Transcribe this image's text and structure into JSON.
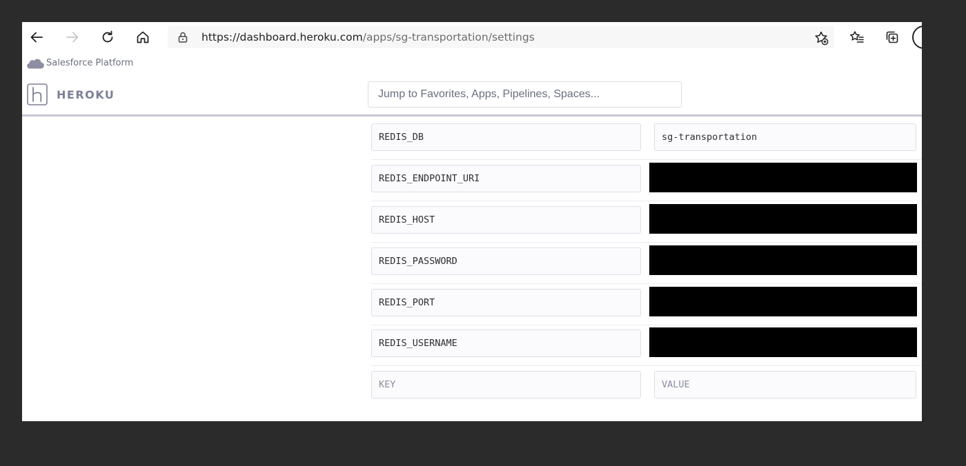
{
  "browser": {
    "url_host": "https://dashboard.heroku.com",
    "url_path": "/apps/sg-transportation/settings",
    "icons": [
      "back-icon",
      "forward-icon",
      "refresh-icon",
      "home-icon",
      "lock-icon",
      "add-favorite-icon",
      "favorites-icon",
      "collections-icon",
      "profile-icon"
    ]
  },
  "salesforce_bar": {
    "label": "Salesforce Platform"
  },
  "heroku": {
    "brand": "HEROKU",
    "search_placeholder": "Jump to Favorites, Apps, Pipelines, Spaces..."
  },
  "config_vars": [
    {
      "key": "REDIS_DB",
      "value": "sg-transportation",
      "redacted": false
    },
    {
      "key": "REDIS_ENDPOINT_URI",
      "value": "",
      "redacted": true
    },
    {
      "key": "REDIS_HOST",
      "value": "",
      "redacted": true
    },
    {
      "key": "REDIS_PASSWORD",
      "value": "",
      "redacted": true
    },
    {
      "key": "REDIS_PORT",
      "value": "",
      "redacted": true
    },
    {
      "key": "REDIS_USERNAME",
      "value": "",
      "redacted": true
    }
  ],
  "new_var": {
    "key_placeholder": "KEY",
    "value_placeholder": "VALUE"
  },
  "colors": {
    "background": "#2b2b2b",
    "heroku_purple": "#7c7f97",
    "header_border": "#c9c7d9",
    "redaction": "#000000"
  }
}
